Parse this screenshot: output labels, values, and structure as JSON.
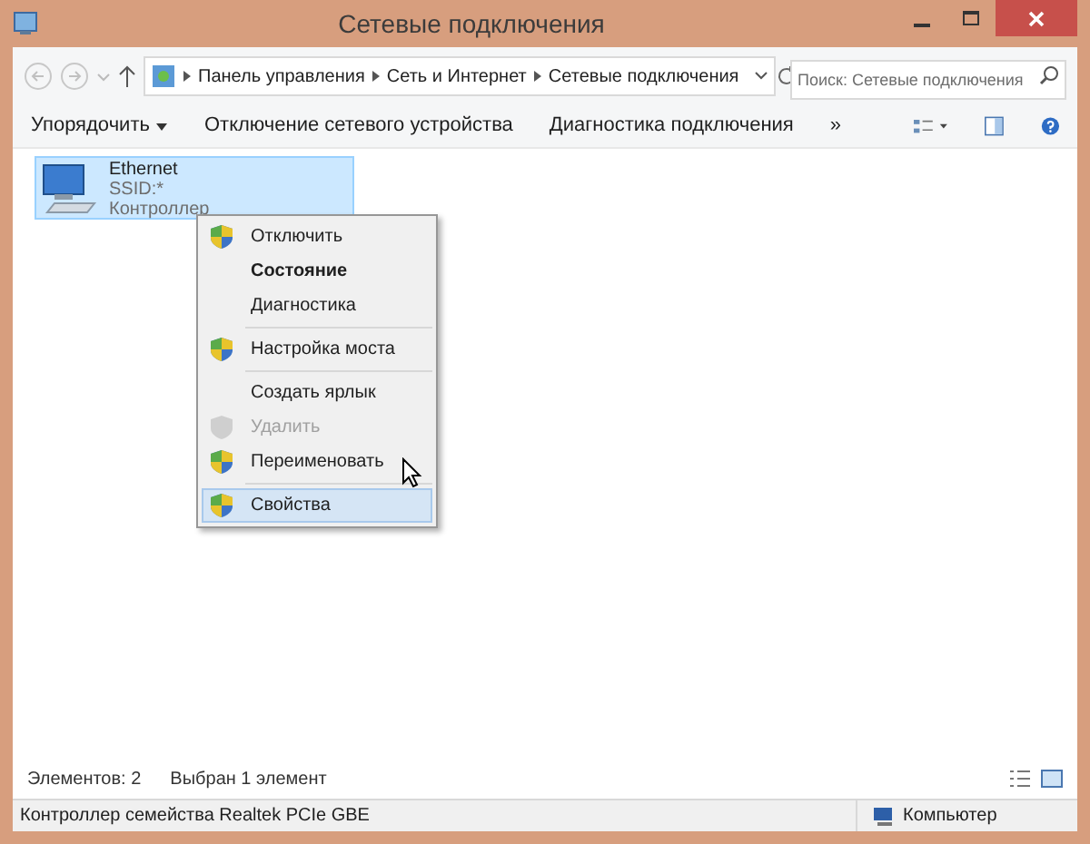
{
  "window": {
    "title": "Сетевые подключения"
  },
  "breadcrumb": [
    "Панель управления",
    "Сеть и Интернет",
    "Сетевые подключения"
  ],
  "search": {
    "placeholder": "Поиск: Сетевые подключения"
  },
  "toolbar": [
    "Упорядочить",
    "Отключение сетевого устройства",
    "Диагностика подключения",
    "»"
  ],
  "item": {
    "name": "Ethernet",
    "line_2": "SSID:*",
    "line_3": "Контроллер",
    "selected": true
  },
  "context_menu": [
    {
      "label": "Отключить",
      "shield": true,
      "bold": false,
      "disabled": false,
      "selected": false,
      "separator_before": false
    },
    {
      "label": "Состояние",
      "shield": false,
      "bold": true,
      "disabled": false,
      "selected": false,
      "separator_before": false
    },
    {
      "label": "Диагностика",
      "shield": false,
      "bold": false,
      "disabled": false,
      "selected": false,
      "separator_before": false
    },
    {
      "label": "Настройка моста",
      "shield": true,
      "bold": false,
      "disabled": false,
      "selected": false,
      "separator_before": true
    },
    {
      "label": "Создать ярлык",
      "shield": false,
      "bold": false,
      "disabled": false,
      "selected": false,
      "separator_before": true
    },
    {
      "label": "Удалить",
      "shield": true,
      "bold": false,
      "disabled": true,
      "selected": false,
      "separator_before": false
    },
    {
      "label": "Переименовать",
      "shield": true,
      "bold": false,
      "disabled": false,
      "selected": false,
      "separator_before": false
    },
    {
      "label": "Свойства",
      "shield": true,
      "bold": false,
      "disabled": false,
      "selected": true,
      "separator_before": true
    }
  ],
  "status": {
    "count": "Элементов: 2",
    "selection": "Выбран 1 элемент"
  },
  "details_bar": {
    "description": "Контроллер семейства Realtek PCIe GBE",
    "zone": "Компьютер"
  }
}
